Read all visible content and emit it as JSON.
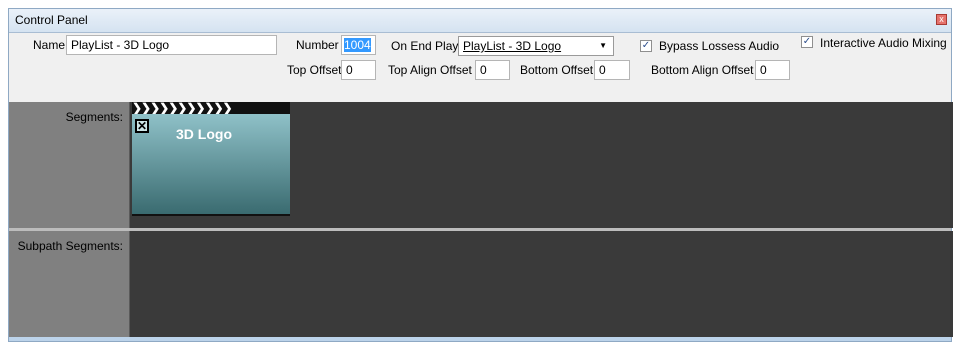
{
  "window": {
    "title": "Control Panel",
    "close_label": "x"
  },
  "props": {
    "name_label": "Name",
    "name_value": "PlayList - 3D Logo",
    "number_label": "Number",
    "number_value": "1004",
    "on_end_play_label": "On End Play",
    "on_end_play_value": "PlayList - 3D Logo",
    "bypass_label": "Bypass Lossess Audio",
    "bypass_checked": true,
    "interactive_label": "Interactive Audio Mixing",
    "interactive_checked": true,
    "top_offset_label": "Top Offset",
    "top_offset_value": "0",
    "top_align_label": "Top Align Offset",
    "top_align_value": "0",
    "bottom_offset_label": "Bottom Offset",
    "bottom_offset_value": "0",
    "bottom_align_label": "Bottom Align Offset",
    "bottom_align_value": "0",
    "check_mark": "✓"
  },
  "segments": {
    "label": "Segments:",
    "items": [
      {
        "title": "3D Logo",
        "strip": "❯❯❯❯❯❯❯❯❯❯❯",
        "x_mark": "✕"
      }
    ]
  },
  "subpath": {
    "label": "Subpath Segments:"
  }
}
